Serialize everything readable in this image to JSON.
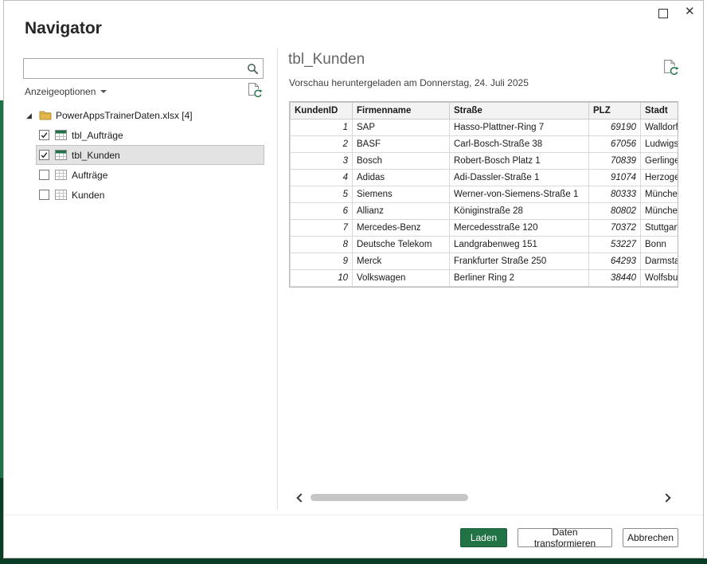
{
  "window": {
    "title": "Navigator"
  },
  "icons": {
    "close_glyph": "✕",
    "expander_glyph": "◢"
  },
  "colors": {
    "accent_green": "#217346",
    "excel_green": "#1e7145",
    "excel_dark_green": "#0b3c25"
  },
  "search": {
    "value": "",
    "placeholder": ""
  },
  "display_options": {
    "label": "Anzeigeoptionen"
  },
  "tree": {
    "root": {
      "label": "PowerAppsTrainerDaten.xlsx [4]"
    },
    "items": [
      {
        "label": "tbl_Aufträge",
        "type": "table",
        "checked": true,
        "selected": false
      },
      {
        "label": "tbl_Kunden",
        "type": "table",
        "checked": true,
        "selected": true
      },
      {
        "label": "Aufträge",
        "type": "sheet",
        "checked": false,
        "selected": false
      },
      {
        "label": "Kunden",
        "type": "sheet",
        "checked": false,
        "selected": false
      }
    ]
  },
  "preview": {
    "title": "tbl_Kunden",
    "subtitle": "Vorschau heruntergeladen am Donnerstag, 24. Juli 2025",
    "table": {
      "columns": [
        "KundenID",
        "Firmenname",
        "Straße",
        "PLZ",
        "Stadt"
      ],
      "numeric_columns": [
        0,
        3
      ],
      "rows": [
        [
          "1",
          "SAP",
          "Hasso-Plattner-Ring 7",
          "69190",
          "Walldorf"
        ],
        [
          "2",
          "BASF",
          "Carl-Bosch-Straße 38",
          "67056",
          "Ludwigshafen"
        ],
        [
          "3",
          "Bosch",
          "Robert-Bosch Platz 1",
          "70839",
          "Gerlingen"
        ],
        [
          "4",
          "Adidas",
          "Adi-Dassler-Straße 1",
          "91074",
          "Herzogenaurach"
        ],
        [
          "5",
          "Siemens",
          "Werner-von-Siemens-Straße 1",
          "80333",
          "München"
        ],
        [
          "6",
          "Allianz",
          "Königinstraße 28",
          "80802",
          "München"
        ],
        [
          "7",
          "Mercedes-Benz",
          "Mercedesstraße 120",
          "70372",
          "Stuttgart"
        ],
        [
          "8",
          "Deutsche Telekom",
          "Landgrabenweg 151",
          "53227",
          "Bonn"
        ],
        [
          "9",
          "Merck",
          "Frankfurter Straße 250",
          "64293",
          "Darmstadt"
        ],
        [
          "10",
          "Volkswagen",
          "Berliner Ring 2",
          "38440",
          "Wolfsburg"
        ]
      ]
    }
  },
  "footer": {
    "load_label": "Laden",
    "transform_label": "Daten transformieren",
    "cancel_label": "Abbrechen"
  }
}
